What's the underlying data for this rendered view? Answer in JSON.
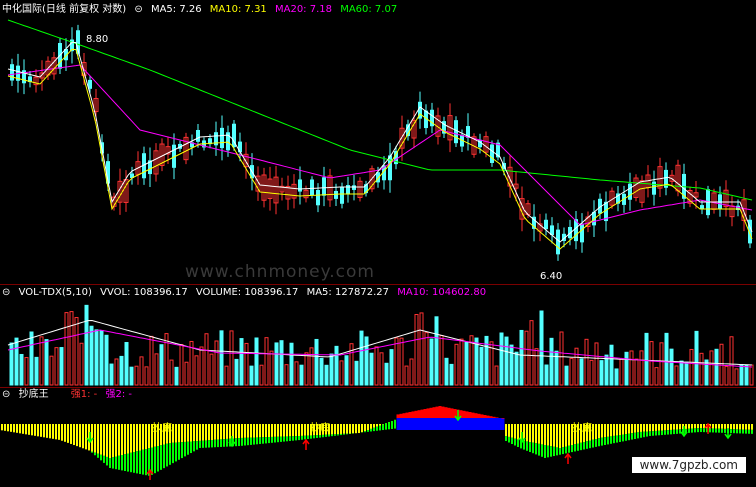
{
  "main": {
    "title": "中化国际(日线 前复权 对数)",
    "ma5": "MA5: 7.26",
    "ma10": "MA10: 7.31",
    "ma20": "MA20: 7.18",
    "ma60": "MA60: 7.07",
    "high_label": "8.80",
    "low_label": "6.40",
    "watermark": "www.chnmoney.com"
  },
  "volume": {
    "title": "VOL-TDX(5,10)",
    "vvol": "VVOL: 108396.17",
    "volume": "VOLUME: 108396.17",
    "ma5": "MA5: 127872.27",
    "ma10": "MA10: 104602.80"
  },
  "indicator": {
    "title": "抄底王",
    "qiang1": "强1: -",
    "qiang2": "强2: -",
    "signal_label": "抄底"
  },
  "site": "www.7gpzb.com",
  "colors": {
    "up": "#ff3232",
    "down": "#54ffff",
    "ma5": "#ffffff",
    "ma10": "#ffff00",
    "ma20": "#ff00ff",
    "ma60": "#00ff00",
    "yellow": "#ffff00",
    "green": "#00ff00",
    "red": "#ff0000",
    "blue": "#0000ff"
  }
}
